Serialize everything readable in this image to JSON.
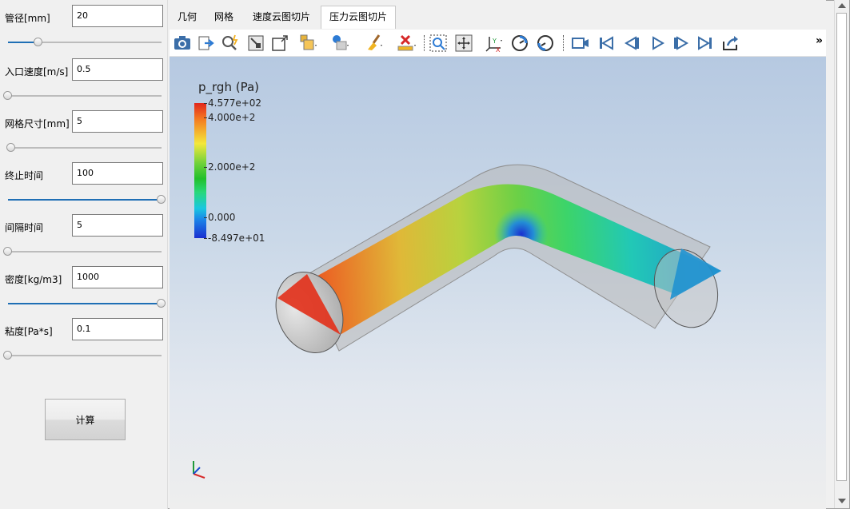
{
  "params": [
    {
      "label": "管径[mm]",
      "value": "20",
      "slider": 0.2
    },
    {
      "label": "入口速度[m/s]",
      "value": "0.5",
      "slider": 0.0
    },
    {
      "label": "网格尺寸[mm]",
      "value": "5",
      "slider": 0.02
    },
    {
      "label": "终止时间",
      "value": "100",
      "slider": 1.0
    },
    {
      "label": "间隔时间",
      "value": "5",
      "slider": 0.0
    },
    {
      "label": "密度[kg/m3]",
      "value": "1000",
      "slider": 1.0
    },
    {
      "label": "粘度[Pa*s]",
      "value": "0.1",
      "slider": 0.0
    }
  ],
  "calc_button": "计算",
  "tabs": [
    {
      "label": "几何",
      "active": false
    },
    {
      "label": "网格",
      "active": false
    },
    {
      "label": "速度云图切片",
      "active": false
    },
    {
      "label": "压力云图切片",
      "active": true
    }
  ],
  "toolbar": {
    "icons": [
      "camera-icon",
      "export-icon",
      "magic-zoom-icon",
      "fit-square-icon",
      "reset-view-icon",
      "box-color-icon",
      "shading-icon",
      "clean-brush-icon",
      "ruler-delete-icon",
      "zoom-to-box-icon",
      "fit-all-icon",
      "axes-icon",
      "rotate-ccw-icon",
      "rotate-cw-icon",
      "record-icon",
      "first-frame-icon",
      "prev-frame-icon",
      "play-icon",
      "next-frame-icon",
      "last-frame-icon",
      "share-icon"
    ],
    "overflow": "»"
  },
  "colorbar": {
    "title": "p_rgh (Pa)",
    "max": "4.577e+02",
    "ticks": [
      "4.000e+2",
      "2.000e+2",
      "0.000"
    ],
    "min": "-8.497e+01",
    "max_value": 457.7,
    "min_value": -84.97,
    "tick_values": [
      400,
      200,
      0
    ]
  },
  "axes": {
    "x": "x",
    "y": "y",
    "z": "z"
  },
  "colors": {
    "accent": "#1f6fb5",
    "high": "#e1261c",
    "low": "#1a2fd0"
  }
}
